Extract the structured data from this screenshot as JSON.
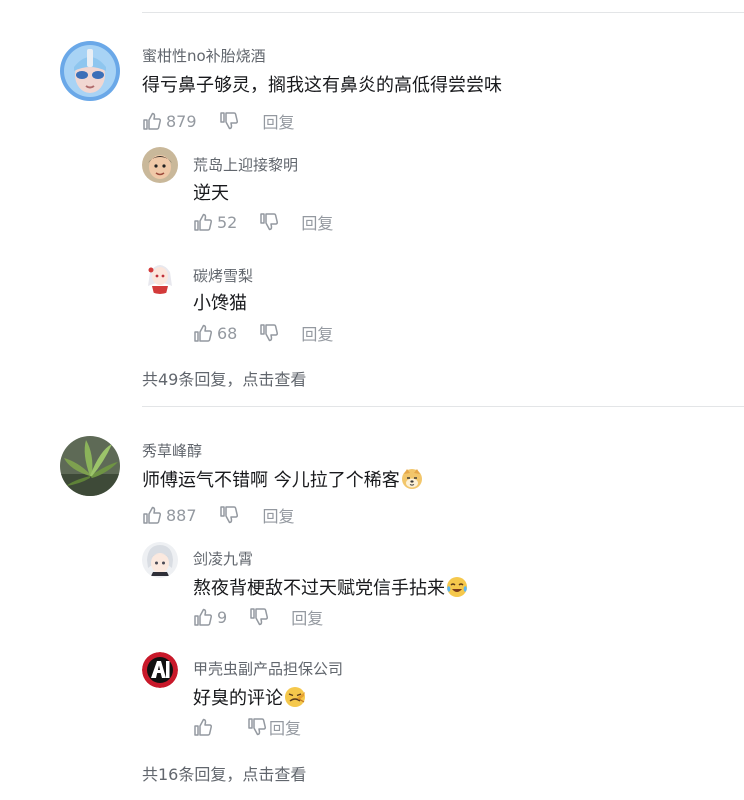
{
  "threads": [
    {
      "user": "蜜柑性no补胎烧酒",
      "text": "得亏鼻子够灵，搁我这有鼻炎的高低得尝尝味",
      "likes": "879",
      "reply_label": "回复",
      "replies": [
        {
          "user": "荒岛上迎接黎明",
          "text": "逆天",
          "likes": "52",
          "reply_label": "回复"
        },
        {
          "user": "碳烤雪梨",
          "text": "小馋猫",
          "likes": "68",
          "reply_label": "回复"
        }
      ],
      "more_replies": "共49条回复，点击查看"
    },
    {
      "user": "秀草峰醇",
      "text": "师傅运气不错啊 今儿拉了个稀客",
      "emoji": "doge-emoji",
      "likes": "887",
      "reply_label": "回复",
      "replies": [
        {
          "user": "剑凌九霄",
          "text": "熬夜背梗敌不过天赋党信手拈来",
          "emoji": "laughing-crying-emoji",
          "likes": "9",
          "reply_label": "回复"
        },
        {
          "user": "甲壳虫副产品担保公司",
          "text": "好臭的评论",
          "emoji": "disgust-emoji",
          "likes": "",
          "reply_label": "回复"
        }
      ],
      "more_replies": "共16条回复，点击查看"
    }
  ],
  "colors": {
    "username": "#61666d",
    "text": "#18191c",
    "meta": "#9499a0",
    "divider": "#e3e5e7"
  }
}
